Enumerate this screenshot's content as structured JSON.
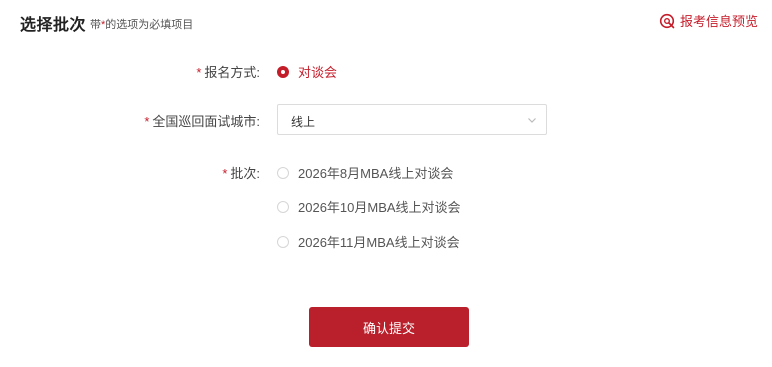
{
  "header": {
    "title": "选择批次",
    "hint_before": "带",
    "hint_star": "*",
    "hint_after": "的选项为必填项目",
    "preview_label": "报考信息预览"
  },
  "form": {
    "mode": {
      "required": "*",
      "label": "报名方式:",
      "option": "对谈会",
      "checked": true
    },
    "city": {
      "required": "*",
      "label": "全国巡回面试城市:",
      "value": "线上"
    },
    "batch": {
      "required": "*",
      "label": "批次:",
      "options": [
        "2026年8月MBA线上对谈会",
        "2026年10月MBA线上对谈会",
        "2026年11月MBA线上对谈会"
      ]
    }
  },
  "submit_label": "确认提交",
  "colors": {
    "accent": "#b9202b",
    "accent_text": "#c41d2a"
  }
}
